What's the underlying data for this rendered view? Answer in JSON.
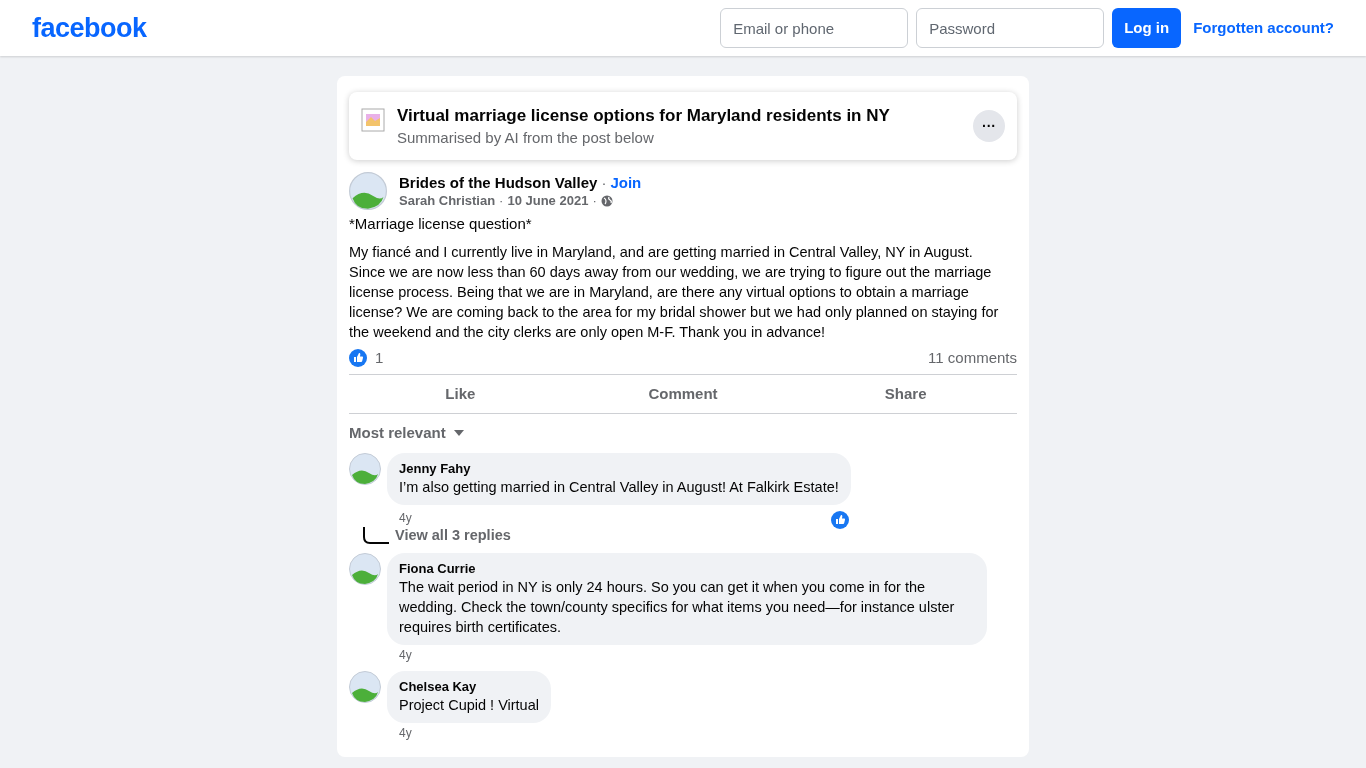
{
  "header": {
    "logo": "facebook",
    "email": {
      "placeholder": "Email or phone"
    },
    "password": {
      "placeholder": "Password"
    },
    "login": "Log in",
    "forgot": "Forgotten account?"
  },
  "summary": {
    "title": "Virtual marriage license options for Maryland residents in NY",
    "subtitle": "Summarised by AI from the post below",
    "more": "···"
  },
  "post": {
    "separator": "·",
    "group": "Brides of the Hudson Valley",
    "join": "Join",
    "author": "Sarah Christian",
    "date": "10 June 2021",
    "heading": "*Marriage license question*",
    "body": "My fiancé and I currently live in Maryland, and are getting married in Central Valley, NY in August. Since we are now less than 60 days away from our wedding, we are trying to figure out the marriage license process. Being that we are in Maryland, are there any virtual options to obtain a marriage license? We are coming back to the area for my bridal shower but we had only planned on staying for the weekend and the city clerks are only open M-F. Thank you in advance!",
    "likes": "1",
    "comments_count": "11 comments"
  },
  "actions": [
    "Like",
    "Comment",
    "Share"
  ],
  "sort": "Most relevant",
  "comments": [
    {
      "name": "Jenny Fahy",
      "text": "I’m also getting married in Central Valley in August! At Falkirk Estate!",
      "time": "4y",
      "liked": true,
      "replies": "View all 3 replies"
    },
    {
      "name": "Fiona Currie",
      "text": "The wait period in NY is only 24 hours. So you can get it when you come in for the wedding. Check the town/county specifics for what items you need—for instance ulster requires birth certificates.",
      "time": "4y",
      "liked": false
    },
    {
      "name": "Chelsea Kay",
      "text": "Project Cupid ! Virtual",
      "time": "4y",
      "liked": false
    }
  ]
}
